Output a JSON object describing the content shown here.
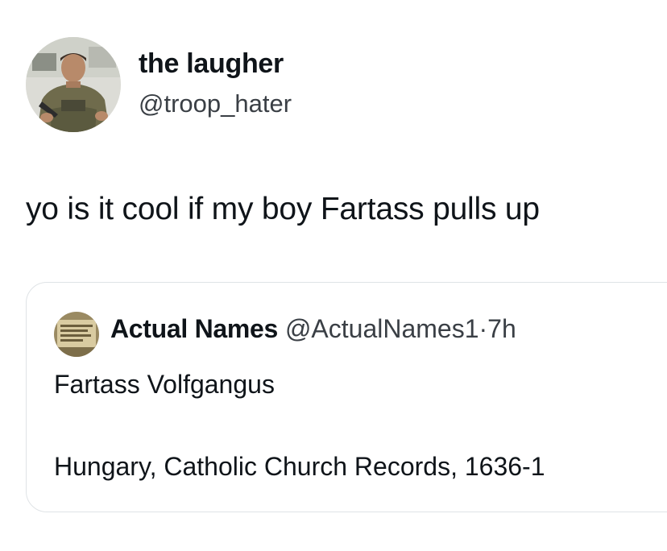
{
  "author": {
    "display_name": "the laugher",
    "handle": "@troop_hater",
    "avatar_icon": "soldier-photo-avatar-icon"
  },
  "tweet": {
    "text": "yo is it cool if my boy Fartass pulls up"
  },
  "quoted_tweet": {
    "display_name": "Actual Names",
    "handle": "@ActualNames1",
    "separator": "·",
    "time": "7h",
    "avatar_icon": "document-scroll-avatar-icon",
    "line1": "Fartass Volfgangus",
    "line2": "Hungary, Catholic Church Records, 1636-1"
  },
  "colors": {
    "text_primary": "#0f1419",
    "text_secondary": "#3a3f45",
    "card_border": "#dfe3e6",
    "background": "#ffffff"
  }
}
